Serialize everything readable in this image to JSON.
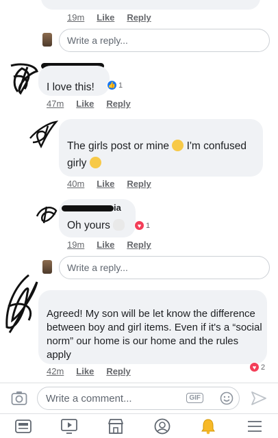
{
  "comments": [
    {
      "text": "I love this!",
      "time": "47m",
      "like_label": "Like",
      "reply_label": "Reply",
      "reaction": {
        "type": "like",
        "count": "1"
      }
    },
    {
      "text_parts": [
        "The girls post or mine ",
        " I'm confused girly "
      ],
      "time": "40m",
      "like_label": "Like",
      "reply_label": "Reply"
    },
    {
      "name_fragment": "ia",
      "text": "Oh yours ",
      "time": "19m",
      "like_label": "Like",
      "reply_label": "Reply",
      "reaction": {
        "type": "love",
        "count": "1"
      }
    },
    {
      "text": "Agreed! My son will be let know the difference between boy and girl items. Even if it's a “social norm” our home is our home and the rules apply",
      "time": "42m",
      "like_label": "Like",
      "reply_label": "Reply",
      "reaction": {
        "type": "love",
        "count": "2"
      }
    }
  ],
  "top_meta": {
    "time": "19m",
    "like_label": "Like",
    "reply_label": "Reply"
  },
  "reply_boxes": [
    {
      "placeholder": "Write a reply..."
    },
    {
      "placeholder": "Write a reply..."
    }
  ],
  "composer": {
    "placeholder": "Write a comment...",
    "gif_label": "GIF"
  },
  "tabbar": [
    "news-feed-icon",
    "watch-icon",
    "marketplace-icon",
    "profile-icon",
    "notifications-icon",
    "menu-icon"
  ],
  "colors": {
    "accent": "#1877f2",
    "love": "#f33e58",
    "bell": "#f7b928"
  }
}
